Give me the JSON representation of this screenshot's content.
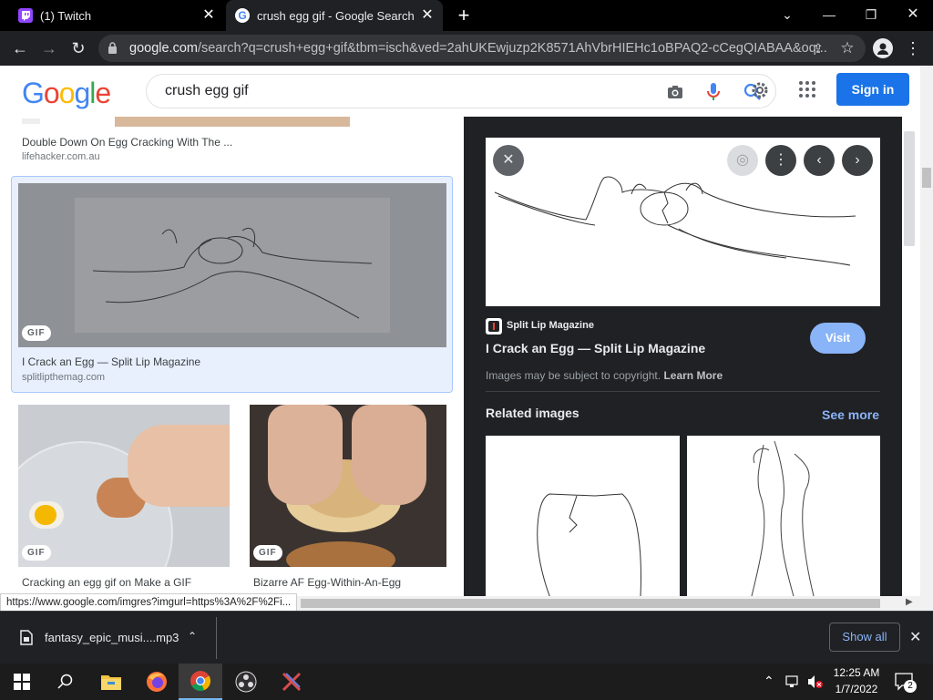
{
  "tabs": [
    {
      "title": "(1) Twitch",
      "favicon": "twitch-icon"
    },
    {
      "title": "crush egg gif - Google Search",
      "favicon": "google-icon",
      "active": true
    }
  ],
  "address": {
    "host": "google.com",
    "path": "/search?q=crush+egg+gif&tbm=isch&ved=2ahUKEwjuzp2K8571AhVbrHIEHc1oBPAQ2-cCegQIABAA&oq..."
  },
  "google": {
    "logo": [
      "G",
      "o",
      "o",
      "g",
      "l",
      "e"
    ],
    "query": "crush egg gif",
    "signin_label": "Sign in"
  },
  "results": [
    {
      "caption": "Double Down On Egg Cracking With The ...",
      "source": "lifehacker.com.au"
    },
    {
      "caption": "I Crack an Egg — Split Lip Magazine",
      "source": "splitlipthemag.com",
      "badge": "GIF"
    },
    {
      "caption": "Cracking an egg gif on Make a GIF",
      "badge": "GIF"
    },
    {
      "caption": "Bizarre AF Egg-Within-An-Egg",
      "badge": "GIF"
    }
  ],
  "preview": {
    "site_name": "Split Lip Magazine",
    "title": "I Crack an Egg — Split Lip Magazine",
    "visit_label": "Visit",
    "copyright_text": "Images may be subject to copyright.",
    "learn_more": "Learn More",
    "related_heading": "Related images",
    "see_more": "See more"
  },
  "status_url": "https://www.google.com/imgres?imgurl=https%3A%2F%2Fi...",
  "download": {
    "filename": "fantasy_epic_musi....mp3",
    "show_all": "Show all"
  },
  "taskbar": {
    "time": "12:25 AM",
    "date": "1/7/2022",
    "notification_count": "2"
  },
  "colors": {
    "google_blue": "#4285f4",
    "google_red": "#ea4335",
    "google_yellow": "#fbbc05",
    "google_green": "#34a853",
    "signin": "#1a73e8",
    "visit": "#8ab4f8",
    "see_more": "#8ab4f8",
    "twitch": "#9146ff"
  }
}
